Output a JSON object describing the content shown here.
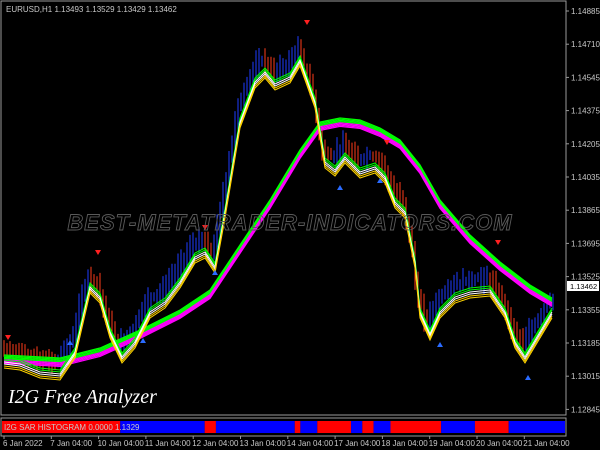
{
  "header": {
    "symbol_info": "EURUSD,H1  1.13493 1.13529 1.13429 1.13462"
  },
  "watermark": "BEST-METATRADER-INDICATORS.COM",
  "overlay_title": "I2G Free Analyzer",
  "subwindow_label": "I2G SAR HISTOGRAM 0.0000 1.1329",
  "price_labels": [
    "1.14885",
    "1.14710",
    "1.14545",
    "1.14375",
    "1.14205",
    "1.14035",
    "1.13865",
    "1.13695",
    "1.13525",
    "1.13355",
    "1.13185",
    "1.13015",
    "1.12845"
  ],
  "current_price": "1.13462",
  "time_labels": [
    "6 Jan 2022",
    "7 Jan 04:00",
    "10 Jan 04:00",
    "11 Jan 04:00",
    "12 Jan 04:00",
    "13 Jan 04:00",
    "14 Jan 04:00",
    "17 Jan 04:00",
    "18 Jan 04:00",
    "19 Jan 04:00",
    "20 Jan 04:00",
    "21 Jan 04:00"
  ],
  "colors": {
    "background": "#000000",
    "bull_candle": "#1e3cff",
    "bear_candle": "#ff3b1a",
    "fast_ribbon_up": "#00ff00",
    "fast_ribbon_down": "#ffd400",
    "slow_ribbon_up": "#00ff00",
    "slow_ribbon_down": "#ff00ff",
    "histogram_blue": "#0000ff",
    "histogram_red": "#ff0000"
  },
  "histogram_segments": [
    {
      "color": "red",
      "from": 0,
      "to": 0.21
    },
    {
      "color": "blue",
      "from": 0.21,
      "to": 0.36
    },
    {
      "color": "red",
      "from": 0.36,
      "to": 0.38
    },
    {
      "color": "blue",
      "from": 0.38,
      "to": 0.52
    },
    {
      "color": "red",
      "from": 0.52,
      "to": 0.53
    },
    {
      "color": "blue",
      "from": 0.53,
      "to": 0.56
    },
    {
      "color": "red",
      "from": 0.56,
      "to": 0.62
    },
    {
      "color": "blue",
      "from": 0.62,
      "to": 0.64
    },
    {
      "color": "red",
      "from": 0.64,
      "to": 0.66
    },
    {
      "color": "blue",
      "from": 0.66,
      "to": 0.69
    },
    {
      "color": "red",
      "from": 0.69,
      "to": 0.78
    },
    {
      "color": "blue",
      "from": 0.78,
      "to": 0.84
    },
    {
      "color": "red",
      "from": 0.84,
      "to": 0.9
    },
    {
      "color": "blue",
      "from": 0.9,
      "to": 1
    }
  ]
}
